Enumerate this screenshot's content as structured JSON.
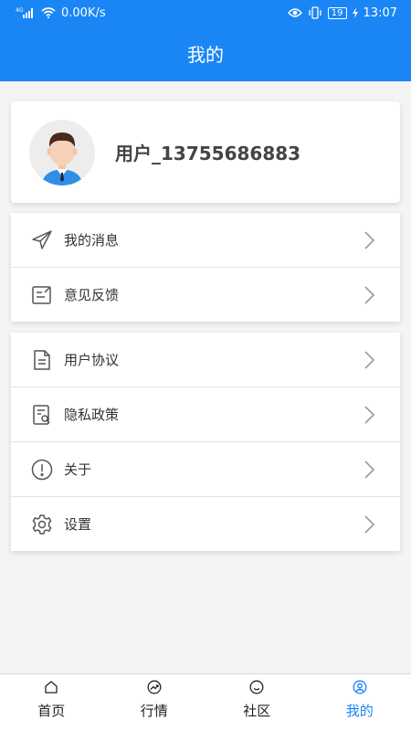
{
  "status_bar": {
    "network": "4G",
    "speed": "0.00K/s",
    "battery": "19",
    "time": "13:07"
  },
  "header": {
    "title": "我的"
  },
  "profile": {
    "username": "用户_13755686883"
  },
  "menu_group_1": [
    {
      "label": "我的消息",
      "icon": "paper-plane-icon"
    },
    {
      "label": "意见反馈",
      "icon": "feedback-edit-icon"
    }
  ],
  "menu_group_2": [
    {
      "label": "用户协议",
      "icon": "document-icon"
    },
    {
      "label": "隐私政策",
      "icon": "privacy-document-icon"
    },
    {
      "label": "关于",
      "icon": "info-exclamation-icon"
    },
    {
      "label": "设置",
      "icon": "gear-icon"
    }
  ],
  "tabs": [
    {
      "label": "首页",
      "icon": "home-icon",
      "active": false
    },
    {
      "label": "行情",
      "icon": "trend-icon",
      "active": false
    },
    {
      "label": "社区",
      "icon": "smile-icon",
      "active": false
    },
    {
      "label": "我的",
      "icon": "user-icon",
      "active": true
    }
  ],
  "colors": {
    "accent": "#1a86f5",
    "background": "#f4f4f4"
  }
}
